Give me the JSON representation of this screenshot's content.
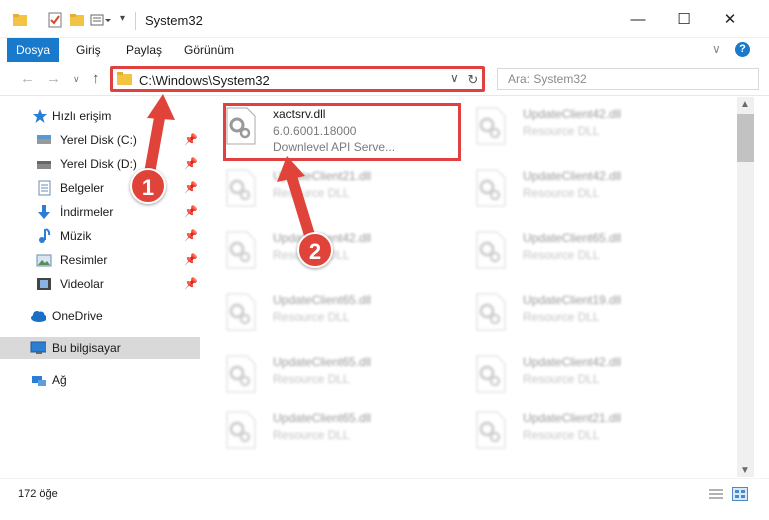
{
  "window": {
    "title": "System32",
    "minimize": "—",
    "maximize": "☐",
    "close": "✕"
  },
  "ribbon": {
    "tabs": [
      {
        "label": "Dosya",
        "active": true
      },
      {
        "label": "Giriş"
      },
      {
        "label": "Paylaş"
      },
      {
        "label": "Görünüm"
      }
    ],
    "help": "?"
  },
  "address": {
    "path": "C:\\Windows\\System32",
    "search_placeholder": "Ara: System32"
  },
  "sidebar": {
    "items": [
      {
        "label": "Hızlı erişim",
        "icon": "star-icon",
        "pinned": false
      },
      {
        "label": "Yerel Disk (C:)",
        "icon": "drive-icon",
        "pinned": true
      },
      {
        "label": "Yerel Disk (D:)",
        "icon": "drive-icon",
        "pinned": true
      },
      {
        "label": "Belgeler",
        "icon": "documents-icon",
        "pinned": true
      },
      {
        "label": "İndirmeler",
        "icon": "download-icon",
        "pinned": true
      },
      {
        "label": "Müzik",
        "icon": "music-icon",
        "pinned": true
      },
      {
        "label": "Resimler",
        "icon": "pictures-icon",
        "pinned": true
      },
      {
        "label": "Videolar",
        "icon": "video-icon",
        "pinned": true
      },
      {
        "label": "OneDrive",
        "icon": "cloud-icon",
        "pinned": false
      },
      {
        "label": "Bu bilgisayar",
        "icon": "computer-icon",
        "pinned": false,
        "selected": true
      },
      {
        "label": "Ağ",
        "icon": "network-icon",
        "pinned": false
      }
    ]
  },
  "files": {
    "highlighted": {
      "name": "xactsrv.dll",
      "version": "6.0.6001.18000",
      "description": "Downlevel API Serve..."
    },
    "items": [
      {
        "name": "UpdateClient42.dll",
        "desc": "Resource DLL"
      },
      {
        "name": "UpdateClient21.dll",
        "desc": "Resource DLL"
      },
      {
        "name": "UpdateClient42.dll",
        "desc": "Resource DLL"
      },
      {
        "name": "UpdateClient42.dll",
        "desc": "Resource DLL"
      },
      {
        "name": "UpdateClient65.dll",
        "desc": "Resource DLL"
      },
      {
        "name": "UpdateClient65.dll",
        "desc": "Resource DLL"
      },
      {
        "name": "UpdateClient19.dll",
        "desc": "Resource DLL"
      },
      {
        "name": "UpdateClient65.dll",
        "desc": "Resource DLL"
      },
      {
        "name": "UpdateClient42.dll",
        "desc": "Resource DLL"
      },
      {
        "name": "UpdateClient65.dll",
        "desc": "Resource DLL"
      },
      {
        "name": "UpdateClient21.dll",
        "desc": "Resource DLL"
      }
    ]
  },
  "status": {
    "item_count": "172 öğe"
  },
  "annotations": {
    "step1": "1",
    "step2": "2",
    "accent_color": "#e0433a"
  }
}
